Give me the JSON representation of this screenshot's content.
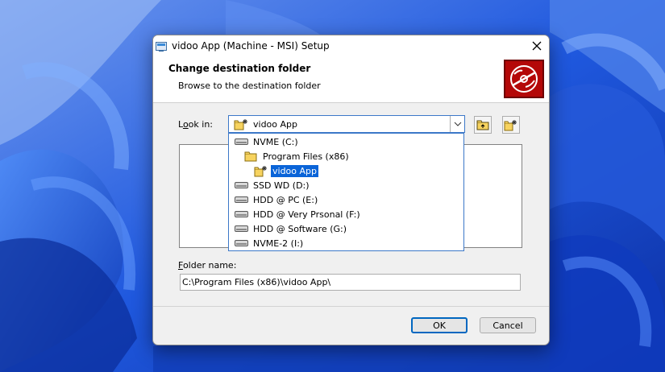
{
  "window": {
    "title": "vidoo App (Machine - MSI) Setup",
    "close_glyph": "✕"
  },
  "header": {
    "title": "Change destination folder",
    "subtitle": "Browse to the destination folder"
  },
  "look_in": {
    "label_prefix": "L",
    "label_underlined": "o",
    "label_suffix": "ok in:",
    "value": "vidoo App"
  },
  "dropdown": {
    "items": [
      {
        "label": "NVME (C:)",
        "icon": "drive-icon",
        "level": 0
      },
      {
        "label": "Program Files (x86)",
        "icon": "folder-icon",
        "level": 1
      },
      {
        "label": "vidoo App",
        "icon": "new-folder-icon",
        "level": 2,
        "selected": true
      },
      {
        "label": "SSD WD (D:)",
        "icon": "drive-icon",
        "level": 0
      },
      {
        "label": "HDD @ PC (E:)",
        "icon": "drive-icon",
        "level": 0
      },
      {
        "label": "HDD @ Very Prsonal (F:)",
        "icon": "drive-icon",
        "level": 0
      },
      {
        "label": "HDD @ Software (G:)",
        "icon": "drive-icon",
        "level": 0
      },
      {
        "label": "NVME-2 (I:)",
        "icon": "drive-icon",
        "level": 0
      }
    ]
  },
  "folder_name": {
    "label_underlined": "F",
    "label_suffix": "older name:",
    "value": "C:\\Program Files (x86)\\vidoo App\\"
  },
  "buttons": {
    "ok": "OK",
    "cancel": "Cancel"
  },
  "colors": {
    "accent": "#0067c0",
    "selection": "#0a64d8",
    "banner": "#b40808"
  }
}
